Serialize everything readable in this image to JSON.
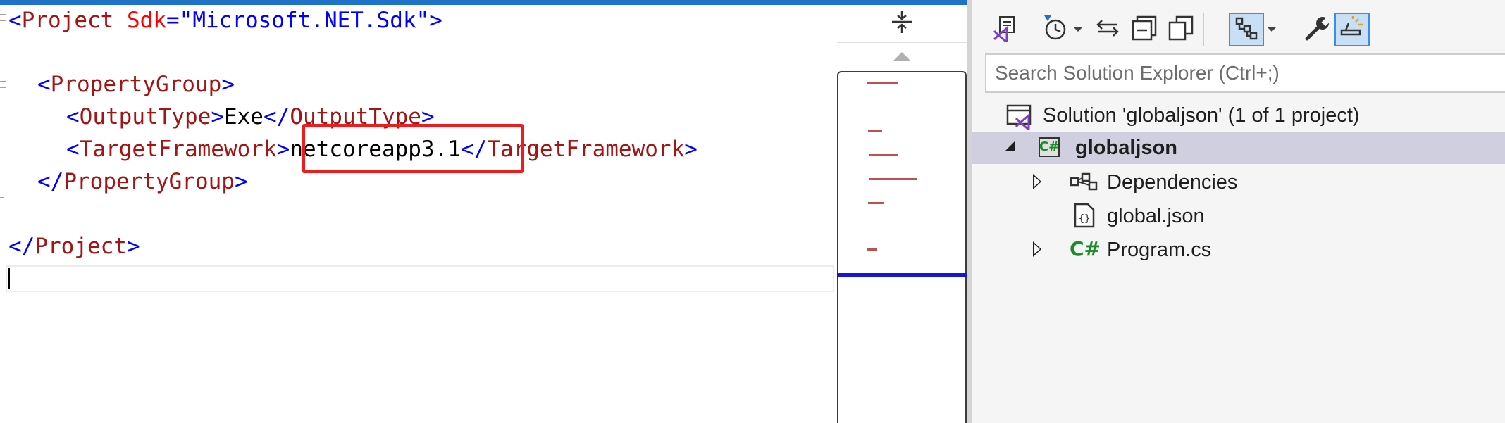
{
  "editor": {
    "lines": [
      {
        "open": "<",
        "tag": "Project",
        "attr": "Sdk",
        "eq": "=",
        "val": "\"Microsoft.NET.Sdk\"",
        "close": ">"
      },
      {
        "open": "<",
        "tag": "PropertyGroup",
        "close": ">"
      },
      {
        "open": "<",
        "tag": "OutputType",
        "close": ">",
        "text": "Exe",
        "end_open": "</",
        "end_tag": "OutputType",
        "end_close": ">"
      },
      {
        "open": "<",
        "tag": "TargetFramework",
        "close": ">",
        "text": "netcoreapp3.1",
        "end_open": "</",
        "end_tag": "TargetFramework",
        "end_close": ">"
      },
      {
        "open": "</",
        "tag": "PropertyGroup",
        "close": ">"
      },
      {
        "open": "</",
        "tag": "Project",
        "close": ">"
      }
    ],
    "highlight_color": "#ee1c1c"
  },
  "scrollbar": {
    "split_icon": "split-view-icon",
    "up_icon": "scroll-up-arrow-icon"
  },
  "solution_explorer": {
    "toolbar": {
      "buttons": [
        {
          "name": "vs-project-icon"
        },
        {
          "name": "history-icon",
          "dropdown": true
        },
        {
          "name": "sync-icon"
        },
        {
          "name": "collapse-all-icon"
        },
        {
          "name": "copy-icon"
        },
        {
          "name": "tree-view-icon",
          "dropdown": true,
          "active": true
        },
        {
          "name": "wrench-icon"
        },
        {
          "name": "preview-icon",
          "active": true
        }
      ]
    },
    "search_placeholder": "Search Solution Explorer (Ctrl+;)",
    "tree": [
      {
        "label": "Solution 'globaljson' (1 of 1 project)",
        "icon": "solution-icon",
        "level": 0
      },
      {
        "label": "globaljson",
        "icon": "csharp-project-icon",
        "level": 1,
        "expanded": true,
        "selected": true,
        "bold": true
      },
      {
        "label": "Dependencies",
        "icon": "dependencies-icon",
        "level": 2,
        "expandable": true
      },
      {
        "label": "global.json",
        "icon": "json-file-icon",
        "level": 2
      },
      {
        "label": "Program.cs",
        "icon": "csharp-file-icon",
        "icon_text": "C#",
        "level": 2,
        "expandable": true
      }
    ],
    "project_icon_text": "C#"
  }
}
